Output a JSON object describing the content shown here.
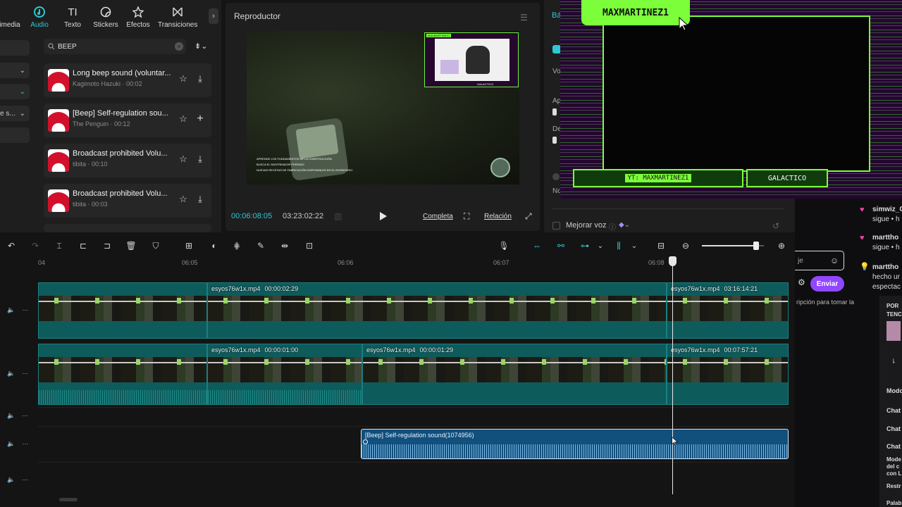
{
  "media_tabs": [
    {
      "label": "imedia",
      "icon": "multimedia-icon",
      "active": false
    },
    {
      "label": "Audio",
      "icon": "audio-icon",
      "active": true
    },
    {
      "label": "Texto",
      "icon": "text-icon",
      "active": false
    },
    {
      "label": "Stickers",
      "icon": "sticker-icon",
      "active": false
    },
    {
      "label": "Efectos",
      "icon": "effects-icon",
      "active": false
    },
    {
      "label": "Transiciones",
      "icon": "transitions-icon",
      "active": false
    }
  ],
  "left_nav": {
    "item_s": "e s..."
  },
  "search": {
    "value": "BEEP"
  },
  "sounds": [
    {
      "title": "Long beep sound (voluntar...",
      "author": "Kagimoto Hazuki",
      "duration": "00:02",
      "action_icon": "download-icon"
    },
    {
      "title": "[Beep] Self-regulation sou...",
      "author": "The Penguin",
      "duration": "00:12",
      "action_icon": "plus-icon"
    },
    {
      "title": "Broadcast prohibited Volu...",
      "author": "tibita",
      "duration": "00:10",
      "action_icon": "download-icon"
    },
    {
      "title": "Broadcast prohibited Volu...",
      "author": "tibita",
      "duration": "00:03",
      "action_icon": "download-icon"
    }
  ],
  "player": {
    "title": "Reproductor",
    "current_time": "00:06:08:05",
    "total_time": "03:23:02:22",
    "full_label": "Completa",
    "ratio_label": "Relación"
  },
  "stream_overlay": {
    "username": "MAXMARTINEZ1",
    "yt_label": "YT: MAXMARTINEZ1",
    "rank_label": "GALACTICO"
  },
  "video_hud": {
    "line1": "APRENDE LOS FUNDAMENTOS DE LA CONSTRUCCIÓN",
    "line2": "BUSCA EL RASTREADOR PERDIDO",
    "line3": "NUEVAS RECETAS DE FABRICACIÓN DISPONIBLES EN EL INVENTARIO",
    "mini_name": "MAXMARTINEZ1",
    "mini_rank": "GALACTICO"
  },
  "properties": {
    "tab_partial": "Bá",
    "labels": [
      "Vo",
      "Ap",
      "De",
      "No"
    ],
    "enhance_voice": "Mejorar voz"
  },
  "chat": {
    "messages": [
      {
        "user": "simwiz_C",
        "text": "sigue • h",
        "color": "#ff3ea5",
        "icon": "heart-icon"
      },
      {
        "user": "marttho",
        "text": "sigue • h",
        "color": "#ff3ea5",
        "icon": "heart-icon"
      },
      {
        "user": "marttho",
        "text": "hecho ur",
        "text2": "espectac",
        "color": "#e0e02a",
        "icon": "bulb-icon"
      }
    ],
    "input_partial": "je",
    "send_label": "Enviar",
    "subscribe_hint": "ripción para tomar la",
    "promo_line1": "POR",
    "promo_line2": "TENC",
    "settings": [
      "Modo",
      "Chat",
      "Chat",
      "Chat",
      "Mode",
      "del c",
      "con L",
      "Restr",
      "Palab"
    ]
  },
  "ruler": {
    "ticks": [
      "04",
      "06:05",
      "06:06",
      "06:07",
      "06:08"
    ]
  },
  "tracks": {
    "video1": [
      {
        "name": "",
        "duration": ""
      },
      {
        "name": "esyos76w1x.mp4",
        "duration": "00:00:02:29"
      },
      {
        "name": "esyos76w1x.mp4",
        "duration": "03:16:14:21"
      }
    ],
    "video2": [
      {
        "name": "",
        "duration": ""
      },
      {
        "name": "esyos76w1x.mp4",
        "duration": "00:00:01:00"
      },
      {
        "name": "esyos76w1x.mp4",
        "duration": "00:00:01:29"
      },
      {
        "name": "esyos76w1x.mp4",
        "duration": "00:07:57:21"
      }
    ],
    "audio_clip": "[Beep] Self-regulation sound(1074956)"
  },
  "zoom": {
    "level": 0.88
  },
  "colors": {
    "accent": "#2cc8d6",
    "overlay_green": "#7cff3a",
    "overlay_purple": "#23072f",
    "twitch_purple": "#9147ff"
  }
}
